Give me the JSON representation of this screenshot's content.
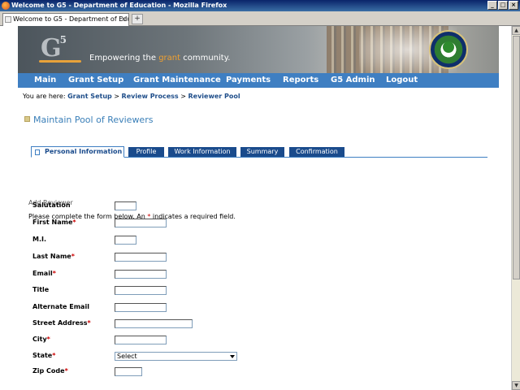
{
  "window": {
    "title": "Welcome to G5 - Department of Education - Mozilla Firefox",
    "min": "_",
    "max": "□",
    "close": "×"
  },
  "browser": {
    "tab_label": "Welcome to G5 - Department of Edu...",
    "tab_close": "×",
    "new_tab": "+"
  },
  "banner": {
    "logo": "G",
    "logo_sup": "5",
    "tagline_pre": "Empowering the ",
    "tagline_accent": "grant",
    "tagline_post": " community."
  },
  "nav": {
    "items": [
      "Main",
      "Grant Setup",
      "Grant Maintenance",
      "Payments",
      "Reports",
      "G5 Admin",
      "Logout"
    ]
  },
  "breadcrumb": {
    "prefix": "You are here:",
    "items": [
      "Grant Setup",
      "Review Process",
      "Reviewer Pool"
    ],
    "separator": " > "
  },
  "page": {
    "title": "Maintain Pool of Reviewers",
    "section": "Add Reviewer",
    "instructions_pre": "Please complete the form below. An ",
    "required_mark": "*",
    "instructions_post": " indicates a required field."
  },
  "tabs": [
    "Personal Information",
    "Profile",
    "Work Information",
    "Summary",
    "Confirmation"
  ],
  "form": {
    "fields": [
      {
        "label": "Salutation",
        "required": ""
      },
      {
        "label": "First Name",
        "required": "*"
      },
      {
        "label": "M.I.",
        "required": ""
      },
      {
        "label": "Last Name",
        "required": "*"
      },
      {
        "label": "Email",
        "required": "*"
      },
      {
        "label": "Title",
        "required": ""
      },
      {
        "label": "Alternate Email",
        "required": ""
      },
      {
        "label": "Street Address",
        "required": "*"
      },
      {
        "label": "City",
        "required": "*"
      },
      {
        "label": "State",
        "required": "*",
        "value": "Select"
      },
      {
        "label": "Zip Code",
        "required": "*"
      }
    ]
  },
  "scrollbar": {
    "up": "▲",
    "down": "▼"
  }
}
